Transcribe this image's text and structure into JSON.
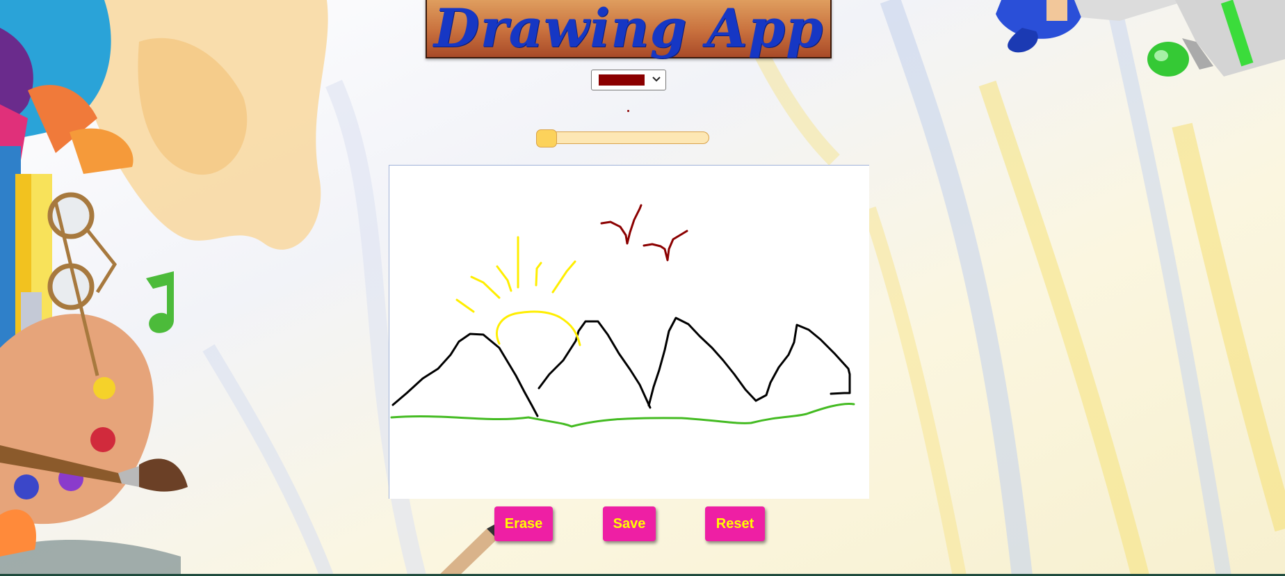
{
  "app": {
    "title": "Drawing App"
  },
  "toolbar": {
    "color_select": {
      "selected_color": "#8b0000",
      "icon": "chevron-down-icon"
    },
    "brush_size_slider": {
      "level_fraction": 0.0
    }
  },
  "actions": {
    "erase_label": "Erase",
    "save_label": "Save",
    "reset_label": "Reset"
  },
  "theme": {
    "title_color": "#1637c4",
    "button_color": "#ee1fa4",
    "button_text_color": "#ffff00",
    "stroke_colors": {
      "mountains": "#000000",
      "grass": "#44bb22",
      "sun": "#ffee00",
      "birds": "#8b0000"
    }
  }
}
